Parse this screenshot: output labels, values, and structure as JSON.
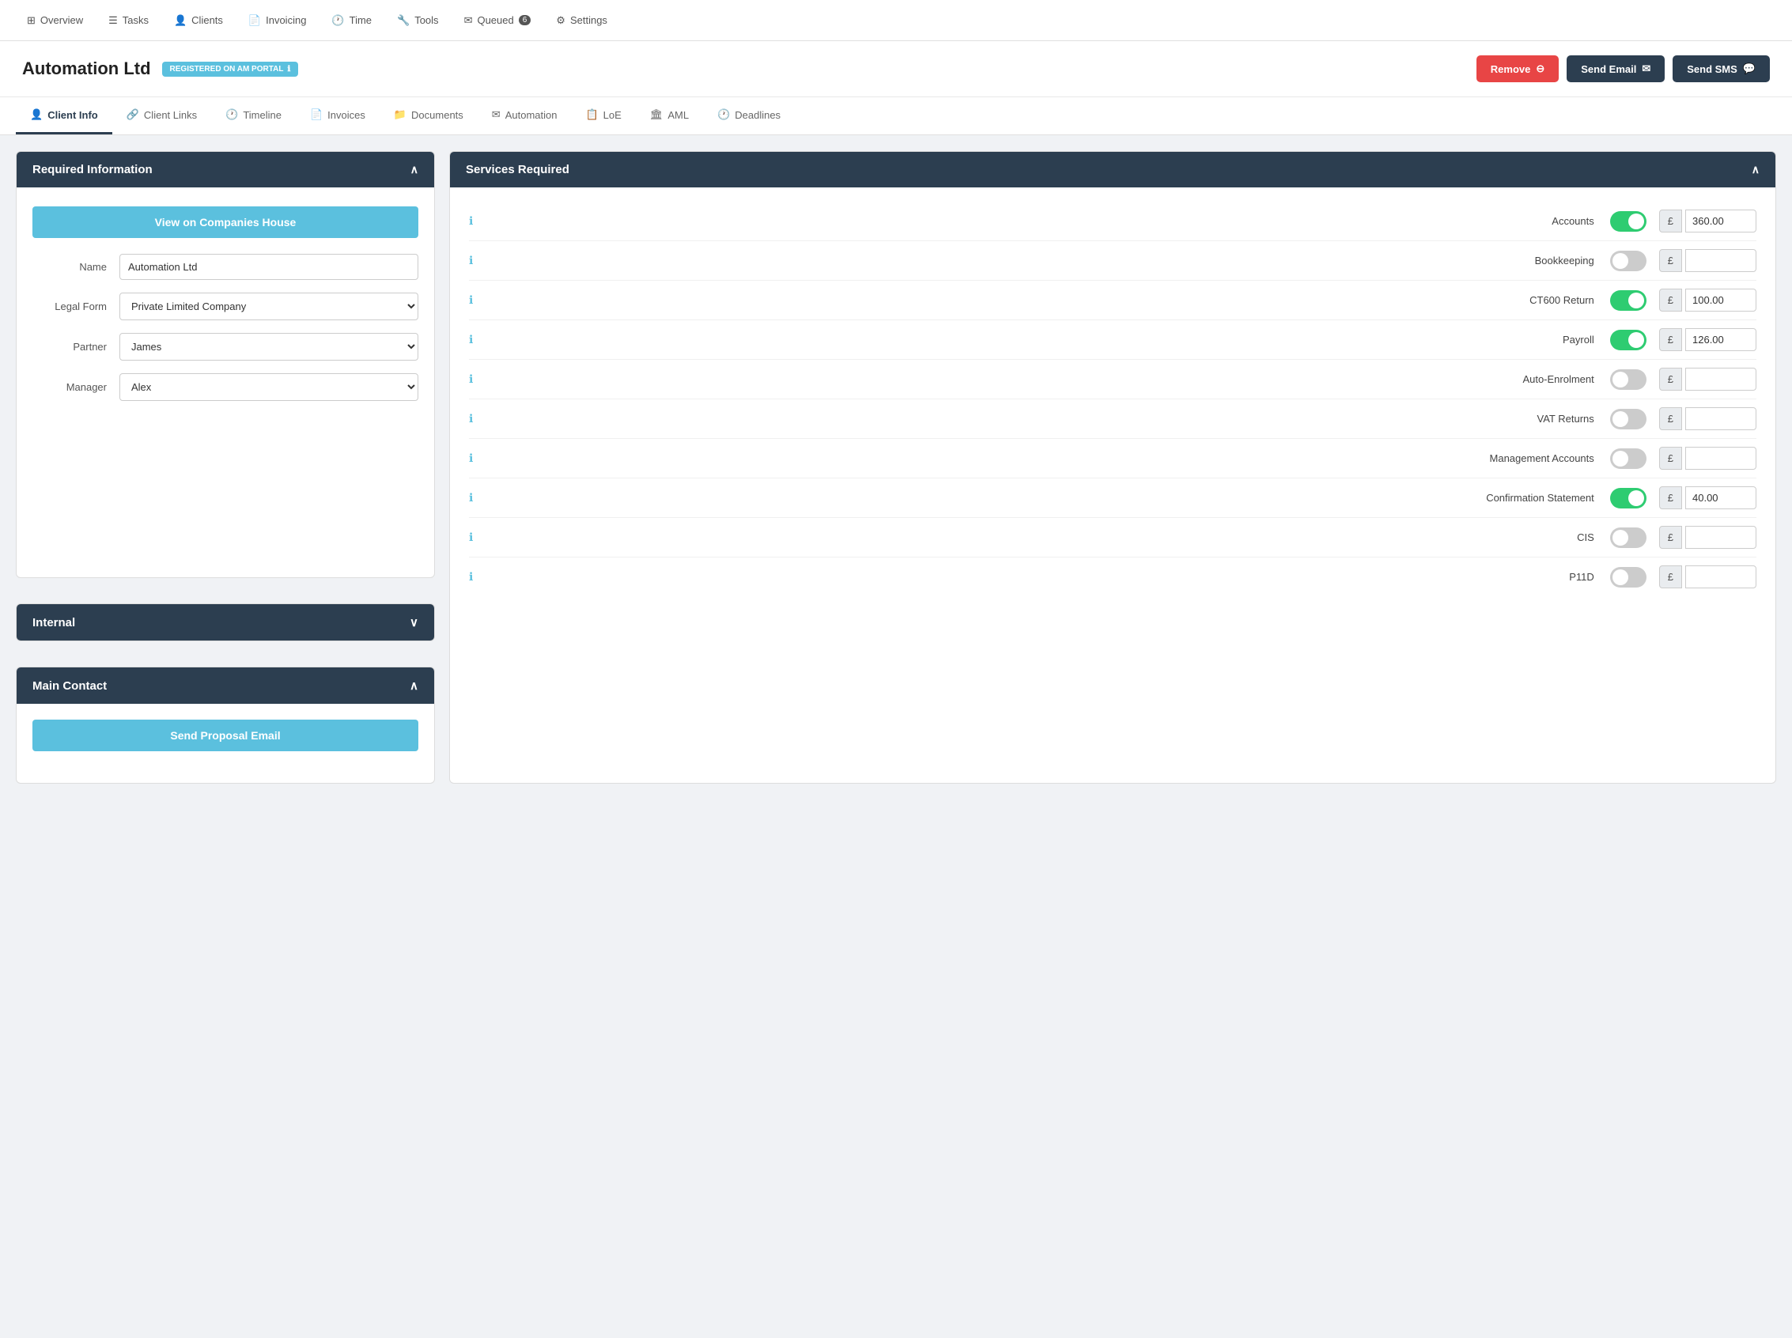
{
  "nav": {
    "items": [
      {
        "label": "Overview",
        "icon": "grid-icon"
      },
      {
        "label": "Tasks",
        "icon": "tasks-icon"
      },
      {
        "label": "Clients",
        "icon": "clients-icon"
      },
      {
        "label": "Invoicing",
        "icon": "invoice-icon"
      },
      {
        "label": "Time",
        "icon": "time-icon"
      },
      {
        "label": "Tools",
        "icon": "tools-icon"
      },
      {
        "label": "Queued",
        "icon": "queued-icon",
        "badge": "6"
      },
      {
        "label": "Settings",
        "icon": "settings-icon"
      }
    ]
  },
  "header": {
    "title": "Automation Ltd",
    "badge": "REGISTERED ON AM PORTAL",
    "badge_icon": "info-icon",
    "remove_btn": "Remove",
    "send_email_btn": "Send Email",
    "send_sms_btn": "Send SMS"
  },
  "tabs": [
    {
      "label": "Client Info",
      "icon": "user-icon",
      "active": true
    },
    {
      "label": "Client Links",
      "icon": "link-icon"
    },
    {
      "label": "Timeline",
      "icon": "clock-icon"
    },
    {
      "label": "Invoices",
      "icon": "doc-icon"
    },
    {
      "label": "Documents",
      "icon": "docs-icon"
    },
    {
      "label": "Automation",
      "icon": "auto-icon"
    },
    {
      "label": "LoE",
      "icon": "loe-icon"
    },
    {
      "label": "AML",
      "icon": "aml-icon"
    },
    {
      "label": "Deadlines",
      "icon": "deadline-icon"
    }
  ],
  "required_info": {
    "title": "Required Information",
    "view_companies_house_btn": "View on Companies House",
    "fields": {
      "name_label": "Name",
      "name_value": "Automation Ltd",
      "legal_form_label": "Legal Form",
      "legal_form_value": "Private Limited Company",
      "partner_label": "Partner",
      "partner_value": "James",
      "manager_label": "Manager",
      "manager_value": "Alex"
    }
  },
  "internal": {
    "title": "Internal"
  },
  "main_contact": {
    "title": "Main Contact",
    "send_proposal_btn": "Send Proposal Email"
  },
  "services": {
    "title": "Services Required",
    "items": [
      {
        "name": "Accounts",
        "enabled": true,
        "price": "360.00"
      },
      {
        "name": "Bookkeeping",
        "enabled": false,
        "price": ""
      },
      {
        "name": "CT600 Return",
        "enabled": true,
        "price": "100.00"
      },
      {
        "name": "Payroll",
        "enabled": true,
        "price": "126.00"
      },
      {
        "name": "Auto-Enrolment",
        "enabled": false,
        "price": ""
      },
      {
        "name": "VAT Returns",
        "enabled": false,
        "price": ""
      },
      {
        "name": "Management Accounts",
        "enabled": false,
        "price": ""
      },
      {
        "name": "Confirmation Statement",
        "enabled": true,
        "price": "40.00"
      },
      {
        "name": "CIS",
        "enabled": false,
        "price": ""
      },
      {
        "name": "P11D",
        "enabled": false,
        "price": ""
      }
    ]
  }
}
